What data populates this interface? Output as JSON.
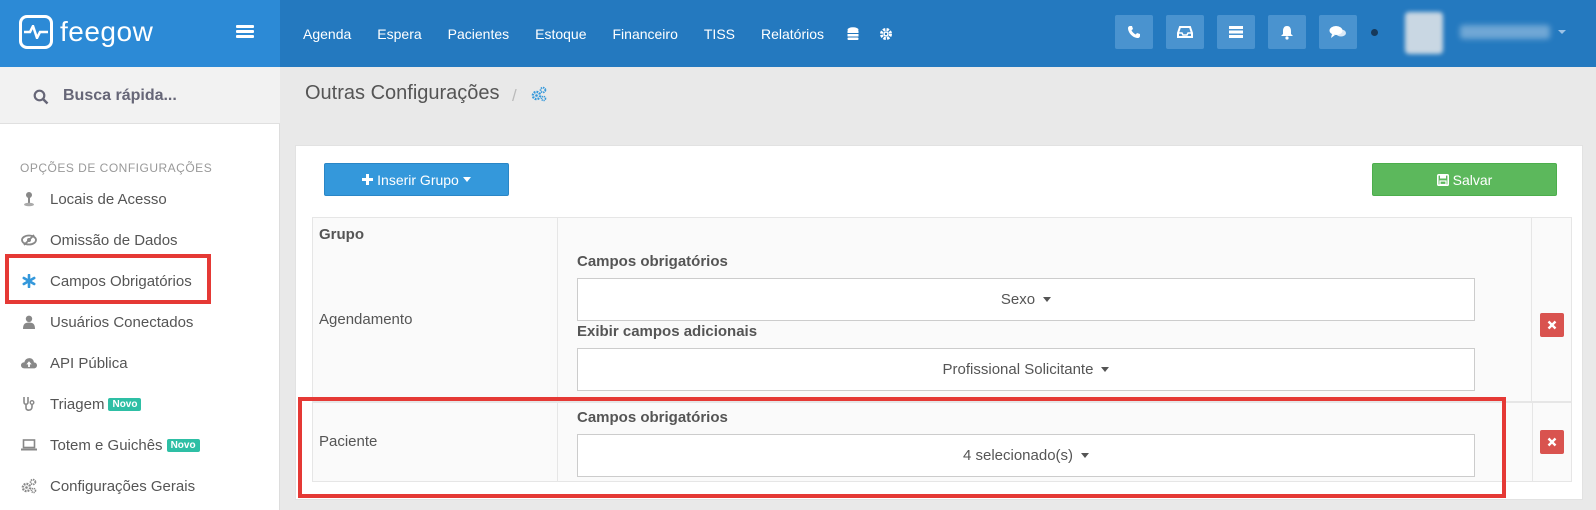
{
  "brand": {
    "name": "feegow"
  },
  "nav": {
    "items": [
      "Agenda",
      "Espera",
      "Pacientes",
      "Estoque",
      "Financeiro",
      "TISS",
      "Relatórios"
    ]
  },
  "search": {
    "label": "Busca rápida..."
  },
  "sidebar": {
    "title": "OPÇÕES DE CONFIGURAÇÕES",
    "items": [
      {
        "label": "Locais de Acesso",
        "icon": "map-pin-icon"
      },
      {
        "label": "Omissão de Dados",
        "icon": "eye-slash-icon"
      },
      {
        "label": "Campos Obrigatórios",
        "icon": "asterisk-icon"
      },
      {
        "label": "Usuários Conectados",
        "icon": "user-icon"
      },
      {
        "label": "API Pública",
        "icon": "cloud-upload-icon"
      },
      {
        "label": "Triagem",
        "icon": "stethoscope-icon",
        "badge": "Novo"
      },
      {
        "label": "Totem e Guichês",
        "icon": "laptop-icon",
        "badge": "Novo"
      },
      {
        "label": "Configurações Gerais",
        "icon": "cogs-icon"
      }
    ]
  },
  "page": {
    "title": "Outras Configurações"
  },
  "toolbar": {
    "insert_label": "Inserir Grupo",
    "save_label": "Salvar"
  },
  "table": {
    "header": "Grupo",
    "rows": [
      {
        "group": "Agendamento",
        "fields": [
          {
            "label": "Campos obrigatórios",
            "value": "Sexo"
          },
          {
            "label": "Exibir campos adicionais",
            "value": "Profissional Solicitante"
          }
        ]
      },
      {
        "group": "Paciente",
        "fields": [
          {
            "label": "Campos obrigatórios",
            "value": "4 selecionado(s)"
          }
        ]
      }
    ]
  },
  "colors": {
    "topbar": "#2479bf",
    "brand": "#2c8ad6",
    "primary": "#3498db",
    "success": "#5cb85c",
    "danger": "#d9534f",
    "highlight": "#e53935"
  }
}
